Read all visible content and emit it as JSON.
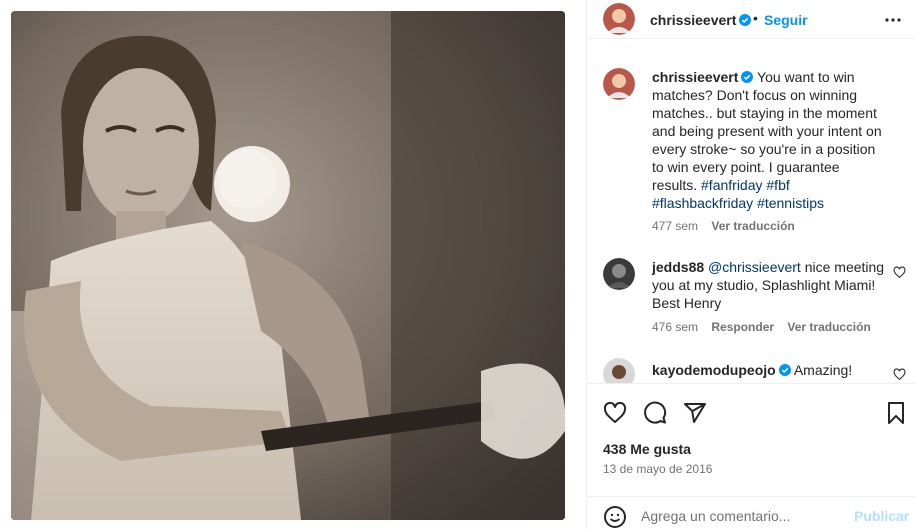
{
  "post": {
    "username": "chrissieevert",
    "follow_label": "Seguir",
    "separator": "•",
    "image_alt": "Vintage photo of tennis player hitting a ball"
  },
  "caption": {
    "username": "chrissieevert",
    "text": "You want to win matches? Don't focus on winning matches.. but staying in the moment and being present with your intent on every stroke~ so you're in a position to win every point. I guarantee results.",
    "hashtags": [
      "#fanfriday",
      "#fbf",
      "#flashbackfriday",
      "#tennistips"
    ],
    "time": "477 sem",
    "translate_label": "Ver traducción"
  },
  "comments": [
    {
      "username": "jedds88",
      "mention": "@chrissieevert",
      "text": "nice meeting you at my studio, Splashlight Miami! Best Henry",
      "time": "476 sem",
      "reply_label": "Responder",
      "translate_label": "Ver traducción"
    },
    {
      "username": "kayodemodupeojo",
      "text": "Amazing!"
    }
  ],
  "stats": {
    "likes": "438 Me gusta",
    "date": "13 de mayo de 2016"
  },
  "composer": {
    "placeholder": "Agrega un comentario...",
    "publish_label": "Publicar"
  },
  "icons": {
    "like": "heart-icon",
    "comment": "comment-icon",
    "share": "share-icon",
    "save": "bookmark-icon",
    "emoji": "emoji-icon",
    "more": "more-options-icon",
    "verified": "verified-badge-icon"
  },
  "colors": {
    "link_blue": "#0095f6",
    "hashtag": "#00376b",
    "muted": "#737373",
    "publish_disabled": "#b2dffc"
  }
}
